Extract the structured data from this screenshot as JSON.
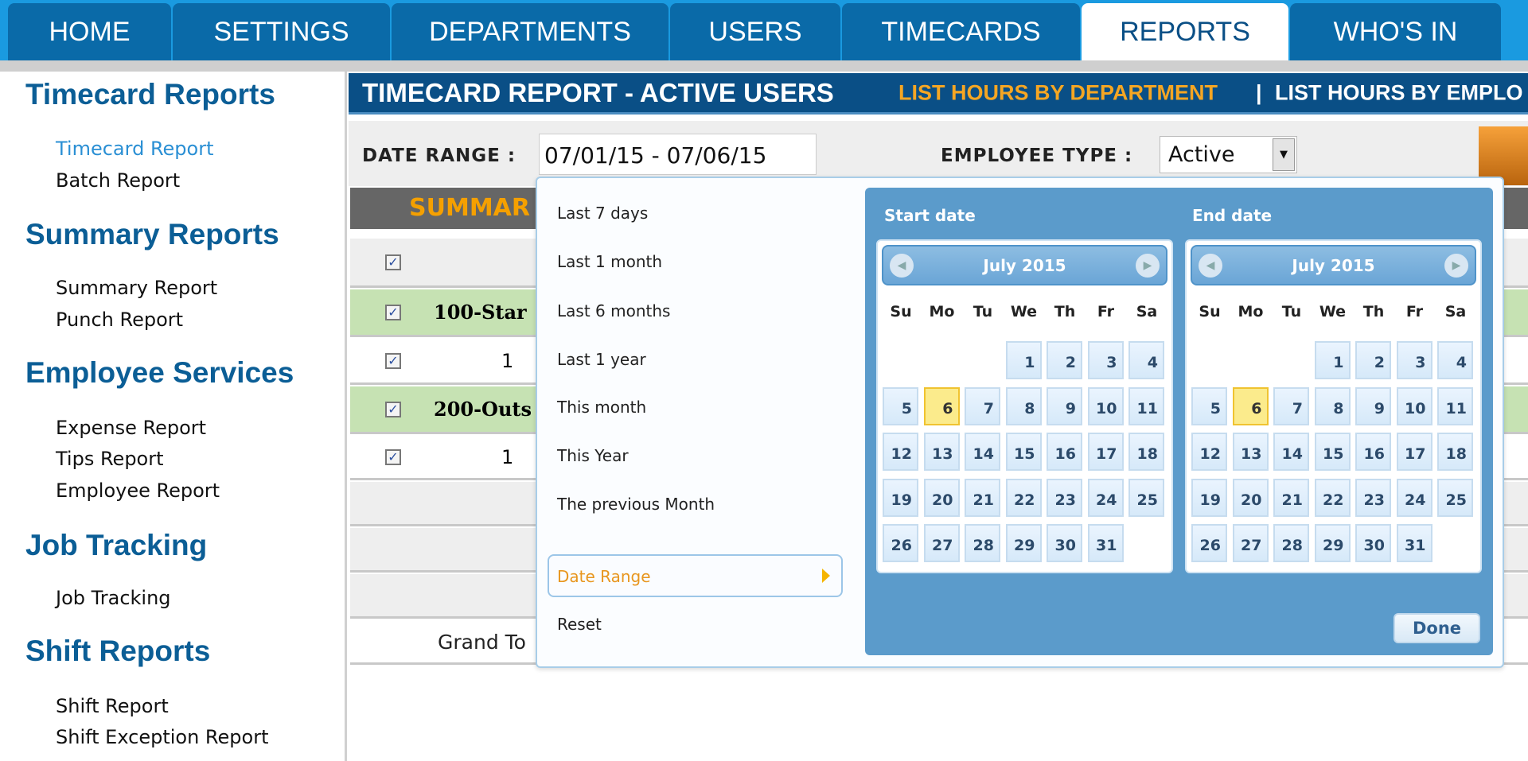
{
  "nav": {
    "tabs": [
      "HOME",
      "SETTINGS",
      "DEPARTMENTS",
      "USERS",
      "TIMECARDS",
      "REPORTS",
      "WHO'S IN"
    ],
    "active": "REPORTS"
  },
  "sidebar": {
    "sections": [
      {
        "title": "Timecard Reports",
        "items": [
          "Timecard Report",
          "Batch Report"
        ]
      },
      {
        "title": "Summary Reports",
        "items": [
          "Summary Report",
          "Punch Report"
        ]
      },
      {
        "title": "Employee Services",
        "items": [
          "Expense Report",
          "Tips Report",
          "Employee Report"
        ]
      },
      {
        "title": "Job Tracking",
        "items": [
          "Job Tracking"
        ]
      },
      {
        "title": "Shift Reports",
        "items": [
          "Shift Report",
          "Shift Exception Report"
        ]
      }
    ],
    "active_item": "Timecard Report"
  },
  "header": {
    "title": "TIMECARD REPORT - ACTIVE USERS",
    "link1": "LIST HOURS BY DEPARTMENT",
    "separator": "|",
    "link2": "LIST HOURS BY EMPLO"
  },
  "filter": {
    "date_range_label": "DATE RANGE :",
    "date_range_value": "07/01/15 - 07/06/15",
    "employee_type_label": "EMPLOYEE TYPE :",
    "employee_type_value": "Active",
    "select_arrow": "▼"
  },
  "table": {
    "summary_title": "SUMMAR",
    "rows": [
      {
        "type": "group",
        "label": "100-Star"
      },
      {
        "type": "item",
        "label": "1"
      },
      {
        "type": "group",
        "label": "200-Outs"
      },
      {
        "type": "item",
        "label": "1"
      }
    ],
    "grand_total": "Grand To"
  },
  "popup": {
    "presets": [
      "Last 7 days",
      "Last 1 month",
      "Last 6 months",
      "Last 1 year",
      "This month",
      "This Year",
      "The previous Month"
    ],
    "date_range": "Date Range",
    "reset": "Reset",
    "start_title": "Start date",
    "end_title": "End date",
    "month_label": "July 2015",
    "weekdays": [
      "Su",
      "Mo",
      "Tu",
      "We",
      "Th",
      "Fr",
      "Sa"
    ],
    "days_in_month": 31,
    "first_weekday_index": 3,
    "selected_start": 6,
    "selected_end": 6,
    "done": "Done"
  },
  "colors": {
    "nav_blue": "#0a6aa8",
    "header_blue": "#0a4f86",
    "link_orange": "#f5a623",
    "calendar_panel": "#5b9bcb",
    "selected_day": "#fbeb8c",
    "group_row_green": "#c6e2b3"
  }
}
